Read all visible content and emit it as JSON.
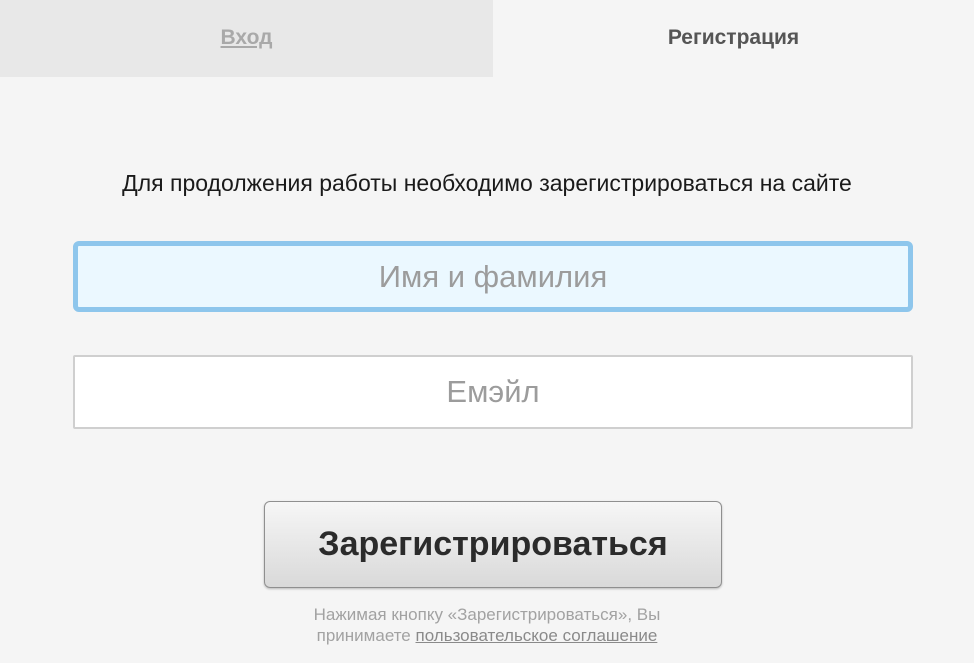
{
  "tabs": {
    "login_label": "Вход",
    "register_label": "Регистрация"
  },
  "form": {
    "intro_text": "Для продолжения работы необходимо зарегистрироваться на сайте",
    "name_placeholder": "Имя и фамилия",
    "name_value": "",
    "email_placeholder": "Емэйл",
    "email_value": "",
    "submit_label": "Зарегистрироваться"
  },
  "note": {
    "line1": "Нажимая кнопку «Зарегистрироваться», Вы",
    "line2_prefix": "принимаете ",
    "agreement_link": "пользовательское соглашение"
  },
  "colors": {
    "background": "#f5f5f5",
    "inactive_tab": "#e8e8e8",
    "focus_border": "#8ec6ec",
    "focus_fill": "#ebf8ff"
  }
}
